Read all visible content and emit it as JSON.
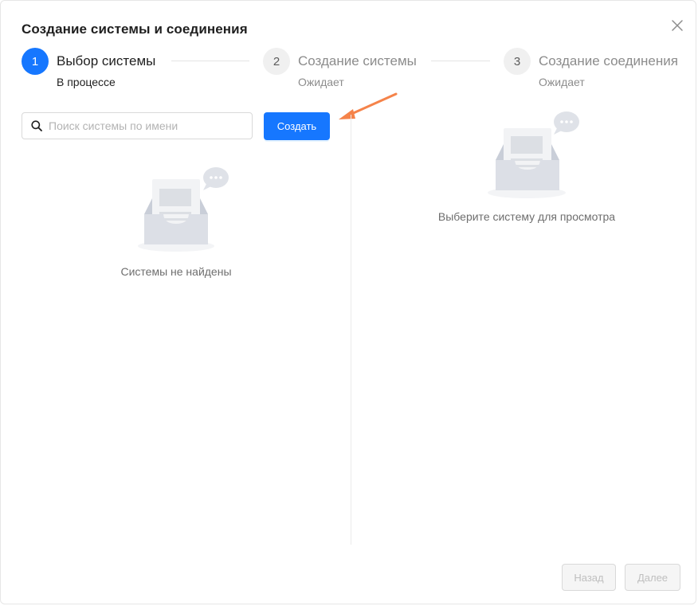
{
  "modal": {
    "title": "Создание системы и соединения"
  },
  "steps": [
    {
      "number": "1",
      "title": "Выбор системы",
      "status": "В процессе"
    },
    {
      "number": "2",
      "title": "Создание системы",
      "status": "Ожидает"
    },
    {
      "number": "3",
      "title": "Создание соединения",
      "status": "Ожидает"
    }
  ],
  "search": {
    "placeholder": "Поиск системы по имени",
    "value": ""
  },
  "toolbar": {
    "create_label": "Создать"
  },
  "left_panel": {
    "empty_text": "Системы не найдены"
  },
  "right_panel": {
    "empty_text": "Выберите систему для просмотра"
  },
  "footer": {
    "back_label": "Назад",
    "next_label": "Далее"
  },
  "colors": {
    "primary": "#1677ff",
    "annotation_arrow": "#f5834a",
    "waiting_circle": "#f0f0f0"
  },
  "icons": {
    "close": "close-icon",
    "search": "search-icon",
    "empty": "empty-inbox-icon",
    "arrow": "annotation-arrow-icon"
  }
}
